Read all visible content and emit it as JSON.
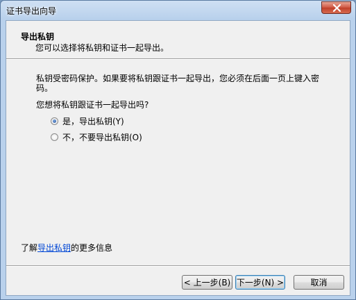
{
  "window": {
    "title": "证书导出向导"
  },
  "header": {
    "title": "导出私钥",
    "subtitle": "您可以选择将私钥和证书一起导出。"
  },
  "body": {
    "description": "私钥受密码保护。如果要将私钥跟证书一起导出，您必须在后面一页上键入密码。",
    "question": "您想将私钥跟证书一起导出吗?",
    "options": [
      {
        "label": "是，导出私钥(Y)",
        "checked": true
      },
      {
        "label": "不，不要导出私钥(O)",
        "checked": false
      }
    ]
  },
  "learn_more": {
    "prefix": "了解",
    "link": "导出私钥",
    "suffix": "的更多信息"
  },
  "buttons": {
    "back": "< 上一步(B)",
    "next": "下一步(N) >",
    "cancel": "取消"
  },
  "colors": {
    "link": "#0046d5",
    "close_button": "#c0402a"
  }
}
